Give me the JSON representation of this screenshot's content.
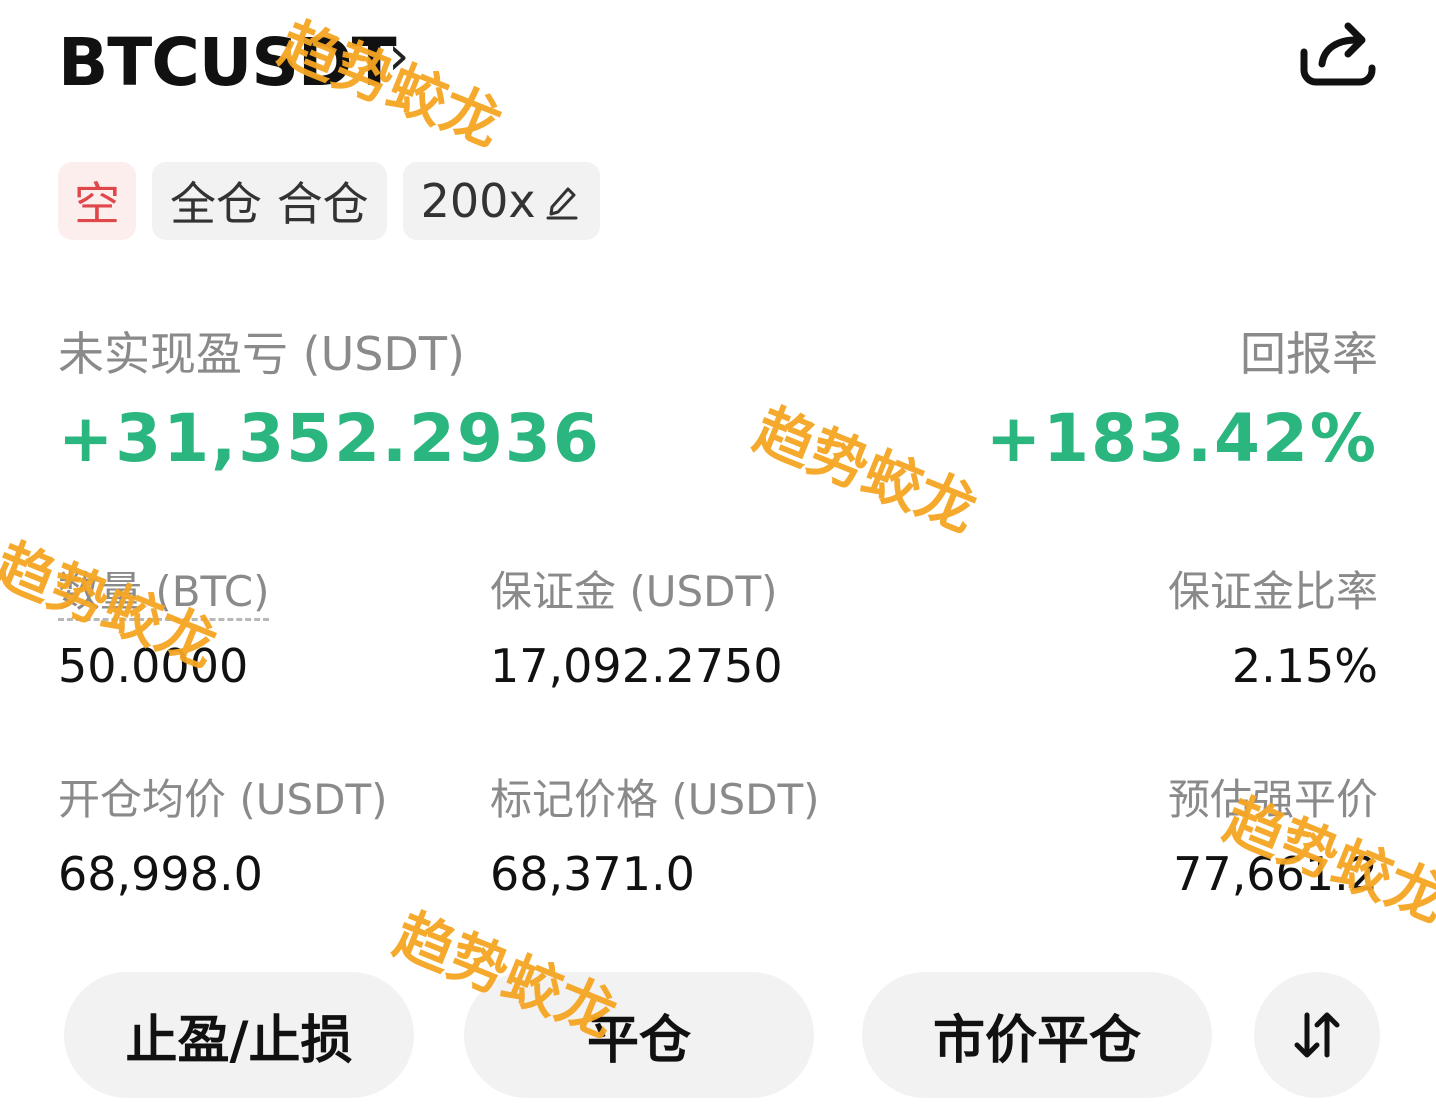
{
  "header": {
    "symbol": "BTCUSDT",
    "chevron": "›",
    "share_icon": "share-icon"
  },
  "tags": {
    "side": "空",
    "margin_mode": "全仓 合仓",
    "leverage": "200x",
    "edit_icon": "pencil-icon"
  },
  "pnl": {
    "label": "未实现盈亏 (USDT)",
    "value": "+31,352.2936",
    "roe_label": "回报率",
    "roe_value": "+183.42%",
    "positive_color": "#2bb57f"
  },
  "stats": {
    "qty_label": "数量 (BTC)",
    "qty_value": "50.0000",
    "margin_label": "保证金 (USDT)",
    "margin_value": "17,092.2750",
    "margin_ratio_label": "保证金比率",
    "margin_ratio_value": "2.15%",
    "entry_label": "开仓均价 (USDT)",
    "entry_value": "68,998.0",
    "mark_label": "标记价格 (USDT)",
    "mark_value": "68,371.0",
    "liq_label": "预估强平价",
    "liq_value": "77,661.2"
  },
  "actions": {
    "tpsl": "止盈/止损",
    "close": "平仓",
    "market_close": "市价平仓",
    "reverse_icon": "swap-vertical-icon"
  },
  "watermark": {
    "text": "趋势蛟龙",
    "color": "#f5a623"
  }
}
